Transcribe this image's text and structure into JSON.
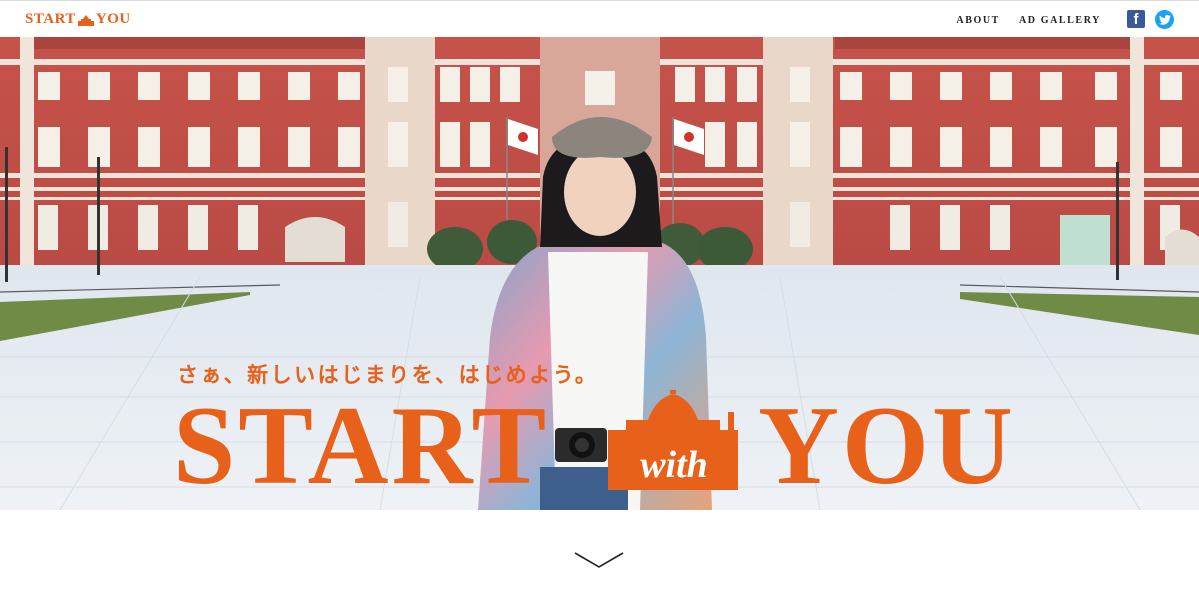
{
  "header": {
    "logo_left": "START",
    "logo_right": "YOU",
    "nav": [
      {
        "label": "ABOUT"
      },
      {
        "label": "AD GALLERY"
      }
    ],
    "facebook_glyph": "f"
  },
  "hero": {
    "tagline": "さぁ、新しいはじまりを、はじめよう。",
    "title_left": "START",
    "title_middle": "with",
    "title_right": "YOU"
  },
  "colors": {
    "accent": "#e8611a",
    "facebook": "#3b5998",
    "twitter": "#1da1f2"
  },
  "icons": [
    "station-logo-icon",
    "facebook-icon",
    "twitter-icon",
    "scroll-down-chevron-icon"
  ]
}
